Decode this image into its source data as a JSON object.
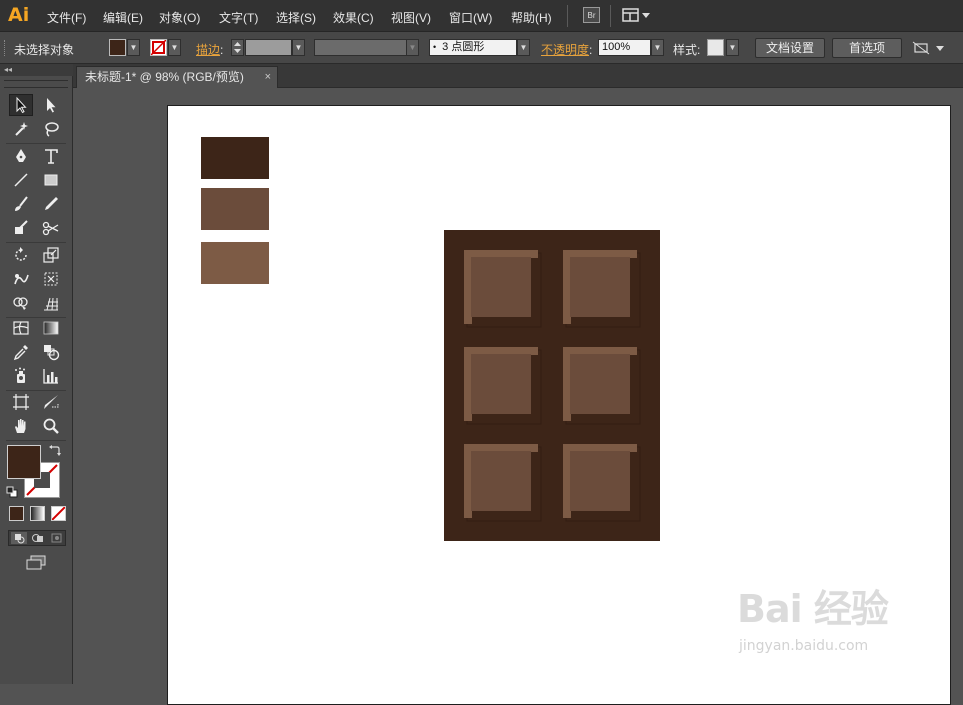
{
  "app": {
    "logo": "Ai"
  },
  "menu": {
    "items": [
      "文件(F)",
      "编辑(E)",
      "对象(O)",
      "文字(T)",
      "选择(S)",
      "效果(C)",
      "视图(V)",
      "窗口(W)",
      "帮助(H)"
    ],
    "bridge_label": "Br"
  },
  "controlbar": {
    "selection_status": "未选择对象",
    "stroke_label": "描边",
    "brush_value": "3 点圆形",
    "opacity_label": "不透明度",
    "opacity_value": "100%",
    "style_label": "样式:",
    "doc_setup_button": "文档设置",
    "preferences_button": "首选项"
  },
  "toolbox": {
    "collapse_glyph": "◂◂"
  },
  "document": {
    "tab_title": "未标题-1* @ 98% (RGB/预览)",
    "tab_close": "×"
  },
  "colors": {
    "dark_brown": "#3d2518",
    "medium_brown": "#6b4c3b",
    "light_brown": "#7d5b45",
    "fill_color": "#3d2518",
    "accent_orange": "#e8a33c",
    "ai_logo": "#f5a623"
  },
  "artwork": {
    "swatches": [
      "#3d2518",
      "#6b4c3b",
      "#7d5b45"
    ],
    "chocolate_grid": {
      "columns": 2,
      "rows": 3
    }
  },
  "watermark": {
    "brand": "Bai 经验",
    "url": "jingyan.baidu.com"
  },
  "icons": {
    "tools": [
      "selection-tool-icon",
      "direct-selection-tool-icon",
      "magic-wand-tool-icon",
      "lasso-tool-icon",
      "pen-tool-icon",
      "type-tool-icon",
      "line-tool-icon",
      "rectangle-tool-icon",
      "paintbrush-tool-icon",
      "pencil-tool-icon",
      "blob-brush-tool-icon",
      "scissors-tool-icon",
      "rotate-tool-icon",
      "scale-tool-icon",
      "warp-tool-icon",
      "free-transform-tool-icon",
      "shape-builder-tool-icon",
      "perspective-grid-tool-icon",
      "mesh-tool-icon",
      "gradient-tool-icon",
      "eyedropper-tool-icon",
      "blend-tool-icon",
      "symbol-sprayer-tool-icon",
      "column-graph-tool-icon",
      "artboard-tool-icon",
      "slice-tool-icon",
      "hand-tool-icon",
      "zoom-tool-icon"
    ]
  }
}
